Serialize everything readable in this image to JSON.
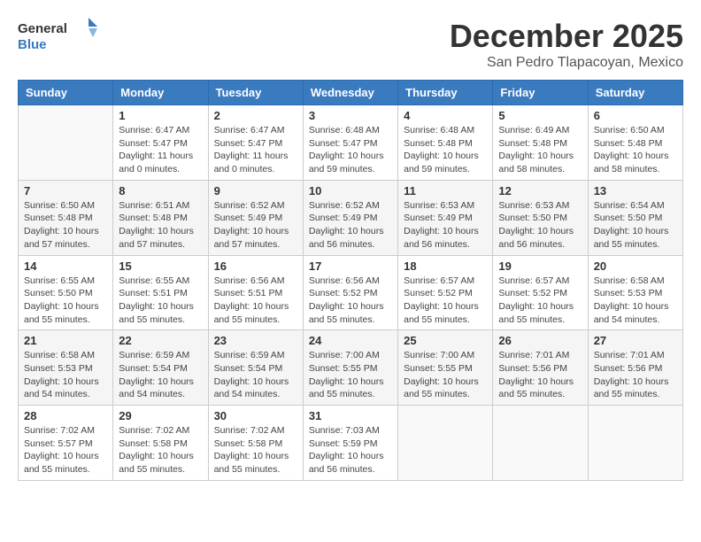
{
  "header": {
    "logo_general": "General",
    "logo_blue": "Blue",
    "month_title": "December 2025",
    "location": "San Pedro Tlapacoyan, Mexico"
  },
  "days_of_week": [
    "Sunday",
    "Monday",
    "Tuesday",
    "Wednesday",
    "Thursday",
    "Friday",
    "Saturday"
  ],
  "weeks": [
    [
      {
        "day": "",
        "sunrise": "",
        "sunset": "",
        "daylight": ""
      },
      {
        "day": "1",
        "sunrise": "Sunrise: 6:47 AM",
        "sunset": "Sunset: 5:47 PM",
        "daylight": "Daylight: 11 hours and 0 minutes."
      },
      {
        "day": "2",
        "sunrise": "Sunrise: 6:47 AM",
        "sunset": "Sunset: 5:47 PM",
        "daylight": "Daylight: 11 hours and 0 minutes."
      },
      {
        "day": "3",
        "sunrise": "Sunrise: 6:48 AM",
        "sunset": "Sunset: 5:47 PM",
        "daylight": "Daylight: 10 hours and 59 minutes."
      },
      {
        "day": "4",
        "sunrise": "Sunrise: 6:48 AM",
        "sunset": "Sunset: 5:48 PM",
        "daylight": "Daylight: 10 hours and 59 minutes."
      },
      {
        "day": "5",
        "sunrise": "Sunrise: 6:49 AM",
        "sunset": "Sunset: 5:48 PM",
        "daylight": "Daylight: 10 hours and 58 minutes."
      },
      {
        "day": "6",
        "sunrise": "Sunrise: 6:50 AM",
        "sunset": "Sunset: 5:48 PM",
        "daylight": "Daylight: 10 hours and 58 minutes."
      }
    ],
    [
      {
        "day": "7",
        "sunrise": "Sunrise: 6:50 AM",
        "sunset": "Sunset: 5:48 PM",
        "daylight": "Daylight: 10 hours and 57 minutes."
      },
      {
        "day": "8",
        "sunrise": "Sunrise: 6:51 AM",
        "sunset": "Sunset: 5:48 PM",
        "daylight": "Daylight: 10 hours and 57 minutes."
      },
      {
        "day": "9",
        "sunrise": "Sunrise: 6:52 AM",
        "sunset": "Sunset: 5:49 PM",
        "daylight": "Daylight: 10 hours and 57 minutes."
      },
      {
        "day": "10",
        "sunrise": "Sunrise: 6:52 AM",
        "sunset": "Sunset: 5:49 PM",
        "daylight": "Daylight: 10 hours and 56 minutes."
      },
      {
        "day": "11",
        "sunrise": "Sunrise: 6:53 AM",
        "sunset": "Sunset: 5:49 PM",
        "daylight": "Daylight: 10 hours and 56 minutes."
      },
      {
        "day": "12",
        "sunrise": "Sunrise: 6:53 AM",
        "sunset": "Sunset: 5:50 PM",
        "daylight": "Daylight: 10 hours and 56 minutes."
      },
      {
        "day": "13",
        "sunrise": "Sunrise: 6:54 AM",
        "sunset": "Sunset: 5:50 PM",
        "daylight": "Daylight: 10 hours and 55 minutes."
      }
    ],
    [
      {
        "day": "14",
        "sunrise": "Sunrise: 6:55 AM",
        "sunset": "Sunset: 5:50 PM",
        "daylight": "Daylight: 10 hours and 55 minutes."
      },
      {
        "day": "15",
        "sunrise": "Sunrise: 6:55 AM",
        "sunset": "Sunset: 5:51 PM",
        "daylight": "Daylight: 10 hours and 55 minutes."
      },
      {
        "day": "16",
        "sunrise": "Sunrise: 6:56 AM",
        "sunset": "Sunset: 5:51 PM",
        "daylight": "Daylight: 10 hours and 55 minutes."
      },
      {
        "day": "17",
        "sunrise": "Sunrise: 6:56 AM",
        "sunset": "Sunset: 5:52 PM",
        "daylight": "Daylight: 10 hours and 55 minutes."
      },
      {
        "day": "18",
        "sunrise": "Sunrise: 6:57 AM",
        "sunset": "Sunset: 5:52 PM",
        "daylight": "Daylight: 10 hours and 55 minutes."
      },
      {
        "day": "19",
        "sunrise": "Sunrise: 6:57 AM",
        "sunset": "Sunset: 5:52 PM",
        "daylight": "Daylight: 10 hours and 55 minutes."
      },
      {
        "day": "20",
        "sunrise": "Sunrise: 6:58 AM",
        "sunset": "Sunset: 5:53 PM",
        "daylight": "Daylight: 10 hours and 54 minutes."
      }
    ],
    [
      {
        "day": "21",
        "sunrise": "Sunrise: 6:58 AM",
        "sunset": "Sunset: 5:53 PM",
        "daylight": "Daylight: 10 hours and 54 minutes."
      },
      {
        "day": "22",
        "sunrise": "Sunrise: 6:59 AM",
        "sunset": "Sunset: 5:54 PM",
        "daylight": "Daylight: 10 hours and 54 minutes."
      },
      {
        "day": "23",
        "sunrise": "Sunrise: 6:59 AM",
        "sunset": "Sunset: 5:54 PM",
        "daylight": "Daylight: 10 hours and 54 minutes."
      },
      {
        "day": "24",
        "sunrise": "Sunrise: 7:00 AM",
        "sunset": "Sunset: 5:55 PM",
        "daylight": "Daylight: 10 hours and 55 minutes."
      },
      {
        "day": "25",
        "sunrise": "Sunrise: 7:00 AM",
        "sunset": "Sunset: 5:55 PM",
        "daylight": "Daylight: 10 hours and 55 minutes."
      },
      {
        "day": "26",
        "sunrise": "Sunrise: 7:01 AM",
        "sunset": "Sunset: 5:56 PM",
        "daylight": "Daylight: 10 hours and 55 minutes."
      },
      {
        "day": "27",
        "sunrise": "Sunrise: 7:01 AM",
        "sunset": "Sunset: 5:56 PM",
        "daylight": "Daylight: 10 hours and 55 minutes."
      }
    ],
    [
      {
        "day": "28",
        "sunrise": "Sunrise: 7:02 AM",
        "sunset": "Sunset: 5:57 PM",
        "daylight": "Daylight: 10 hours and 55 minutes."
      },
      {
        "day": "29",
        "sunrise": "Sunrise: 7:02 AM",
        "sunset": "Sunset: 5:58 PM",
        "daylight": "Daylight: 10 hours and 55 minutes."
      },
      {
        "day": "30",
        "sunrise": "Sunrise: 7:02 AM",
        "sunset": "Sunset: 5:58 PM",
        "daylight": "Daylight: 10 hours and 55 minutes."
      },
      {
        "day": "31",
        "sunrise": "Sunrise: 7:03 AM",
        "sunset": "Sunset: 5:59 PM",
        "daylight": "Daylight: 10 hours and 56 minutes."
      },
      {
        "day": "",
        "sunrise": "",
        "sunset": "",
        "daylight": ""
      },
      {
        "day": "",
        "sunrise": "",
        "sunset": "",
        "daylight": ""
      },
      {
        "day": "",
        "sunrise": "",
        "sunset": "",
        "daylight": ""
      }
    ]
  ]
}
